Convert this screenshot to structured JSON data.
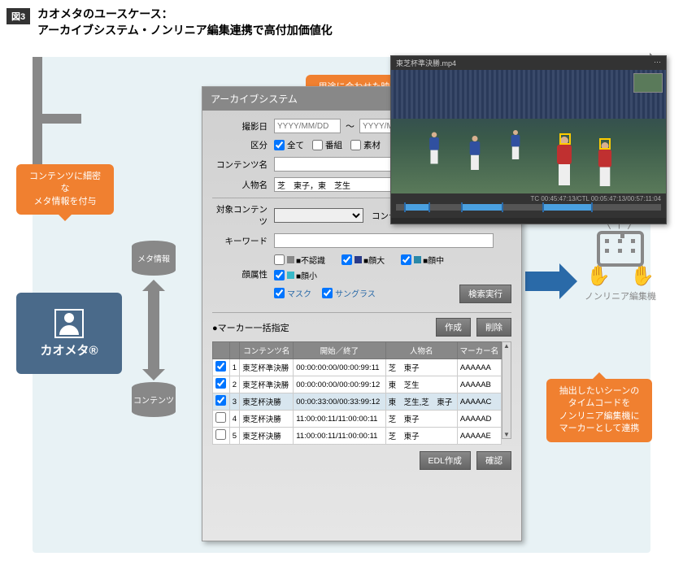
{
  "figure_label": "図3",
  "title_line1": "カオメタのユースケース：",
  "title_line2": "アーカイブシステム・ノンリニア編集連携で高付加価値化",
  "callouts": {
    "meta": "コンテンツに細密な\nメタ情報を付与",
    "extract": "用途に合わせた映像を\n効率的に抽出",
    "marker": "抽出したいシーンの\nタイムコードを\nノンリニア編集機に\nマーカーとして連携"
  },
  "db": {
    "meta": "メタ情報",
    "contents": "コンテンツ"
  },
  "kaometa": "カオメタ®",
  "nle_label": "ノンリニア編集機",
  "panel": {
    "header": "アーカイブシステム",
    "labels": {
      "shoot_date": "撮影日",
      "date_sep": "〜",
      "category": "区分",
      "cat_all": "全て",
      "cat_program": "番組",
      "cat_material": "素材",
      "content_name": "コンテンツ名",
      "person_name": "人物名",
      "target_content": "対象コンテンツ",
      "content_code": "コンテンツコード",
      "keyword": "キーワード",
      "face_attr": "顔属性",
      "fa_unknown": "■不認識",
      "fa_large": "■顔大",
      "fa_mid": "■顔中",
      "fa_small": "■顔小",
      "fa_mask": "マスク",
      "fa_sunglass": "サングラス",
      "btn_search": "検索実行",
      "marker_batch": "●マーカー一括指定",
      "btn_create": "作成",
      "btn_delete": "削除",
      "btn_edl": "EDL作成",
      "btn_confirm": "確認"
    },
    "values": {
      "date_placeholder": "YYYY/MM/DD",
      "person_name_value": "芝　東子，東　芝生"
    },
    "face_colors": {
      "unknown": "#888888",
      "large": "#2a3a88",
      "mid": "#2a88a8",
      "small": "#38b8c8"
    },
    "table": {
      "cols": [
        "",
        "",
        "コンテンツ名",
        "開始／終了",
        "人物名",
        "マーカー名"
      ],
      "rows": [
        {
          "chk": true,
          "n": "1",
          "content": "東芝杯準決勝",
          "se": "00:00:00:00/00:00:99:11",
          "person": "芝　東子",
          "marker": "AAAAAA"
        },
        {
          "chk": true,
          "n": "2",
          "content": "東芝杯準決勝",
          "se": "00:00:00:00/00:00:99:12",
          "person": "東　芝生",
          "marker": "AAAAAB"
        },
        {
          "chk": true,
          "n": "3",
          "content": "東芝杯決勝",
          "se": "00:00:33:00/00:33:99:12",
          "person": "東　芝生,芝　東子",
          "marker": "AAAAAC",
          "sel": true
        },
        {
          "chk": false,
          "n": "4",
          "content": "東芝杯決勝",
          "se": "11:00:00:11/11:00:00:11",
          "person": "芝　東子",
          "marker": "AAAAAD"
        },
        {
          "chk": false,
          "n": "5",
          "content": "東芝杯決勝",
          "se": "11:00:00:11/11:00:00:11",
          "person": "芝　東子",
          "marker": "AAAAAE"
        }
      ]
    }
  },
  "video": {
    "filename": "東芝杯準決勝.mp4",
    "timecode": "TC 00:45:47:13/CTL 00:05:47:13/00:57:11:04"
  }
}
